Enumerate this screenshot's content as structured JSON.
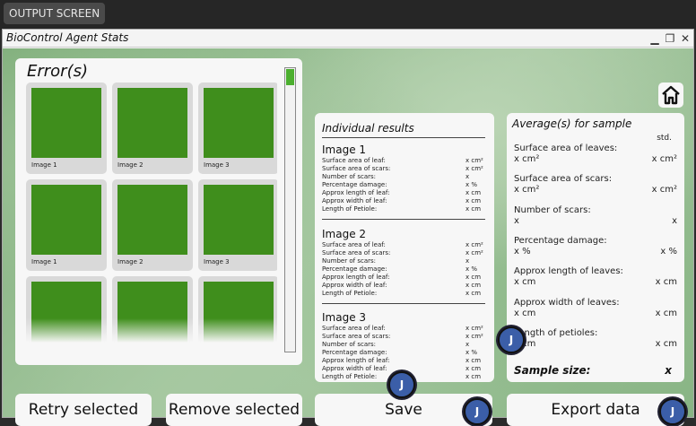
{
  "topbar": {
    "output_label": "OUTPUT SCREEN"
  },
  "window": {
    "title": "BioControl Agent Stats",
    "controls": {
      "minimize": "▁",
      "restore": "❐",
      "close": "✕"
    }
  },
  "errors": {
    "title": "Error(s)",
    "tiles": [
      {
        "label": "Image 1"
      },
      {
        "label": "Image 2"
      },
      {
        "label": "Image 3"
      },
      {
        "label": "Image 1"
      },
      {
        "label": "Image 2"
      },
      {
        "label": "Image 3"
      },
      {
        "label": ""
      },
      {
        "label": ""
      },
      {
        "label": ""
      }
    ],
    "tile_color": "#3f8e1c"
  },
  "individual": {
    "title": "Individual results",
    "images": [
      {
        "title": "Image 1",
        "rows": [
          {
            "label": "Surface area of leaf:",
            "value": "x cm²"
          },
          {
            "label": "Surface area of scars:",
            "value": "x cm²"
          },
          {
            "label": "Number of scars:",
            "value": "x"
          },
          {
            "label": "Percentage damage:",
            "value": "x   %"
          },
          {
            "label": "Approx length of leaf:",
            "value": "x cm"
          },
          {
            "label": "Approx width of leaf:",
            "value": "x cm"
          },
          {
            "label": "Length of Petiole:",
            "value": "x cm"
          }
        ]
      },
      {
        "title": "Image 2",
        "rows": [
          {
            "label": "Surface area of leaf:",
            "value": "x cm²"
          },
          {
            "label": "Surface area of scars:",
            "value": "x cm²"
          },
          {
            "label": "Number of scars:",
            "value": "x"
          },
          {
            "label": "Percentage damage:",
            "value": "x   %"
          },
          {
            "label": "Approx length of leaf:",
            "value": "x cm"
          },
          {
            "label": "Approx width of leaf:",
            "value": "x cm"
          },
          {
            "label": "Length of Petiole:",
            "value": "x cm"
          }
        ]
      },
      {
        "title": "Image 3",
        "rows": [
          {
            "label": "Surface area of leaf:",
            "value": "x cm²"
          },
          {
            "label": "Surface area of scars:",
            "value": "x cm²"
          },
          {
            "label": "Number of scars:",
            "value": "x"
          },
          {
            "label": "Percentage damage:",
            "value": "x   %"
          },
          {
            "label": "Approx length of leaf:",
            "value": "x cm"
          },
          {
            "label": "Approx width of leaf:",
            "value": "x cm"
          },
          {
            "label": "Length of Petiole:",
            "value": "x cm"
          }
        ]
      }
    ]
  },
  "average": {
    "title": "Average(s) for sample",
    "std_label": "std.",
    "rows": [
      {
        "label": "Surface area of leaves:",
        "value": "x cm²",
        "std": "x cm²"
      },
      {
        "label": "Surface area of scars:",
        "value": "x cm²",
        "std": "x cm²"
      },
      {
        "label": "Number of scars:",
        "value": "x",
        "std": "x"
      },
      {
        "label": "Percentage damage:",
        "value": "x %",
        "std": "x %"
      },
      {
        "label": "Approx length of leaves:",
        "value": "x cm",
        "std": "x cm"
      },
      {
        "label": "Approx width of leaves:",
        "value": "x cm",
        "std": "x cm"
      },
      {
        "label": "Length of petioles:",
        "value": "x cm",
        "std": "x cm"
      }
    ],
    "sample_size_label": "Sample size:",
    "sample_size_value": "x"
  },
  "buttons": {
    "retry": "Retry selected",
    "remove": "Remove selected",
    "save": "Save",
    "export": "Export data"
  },
  "icons": {
    "home": "home-icon",
    "avatar_letter": "J"
  },
  "colors": {
    "accent_green": "#4caf2f",
    "avatar_blue": "#3b5ea8"
  }
}
